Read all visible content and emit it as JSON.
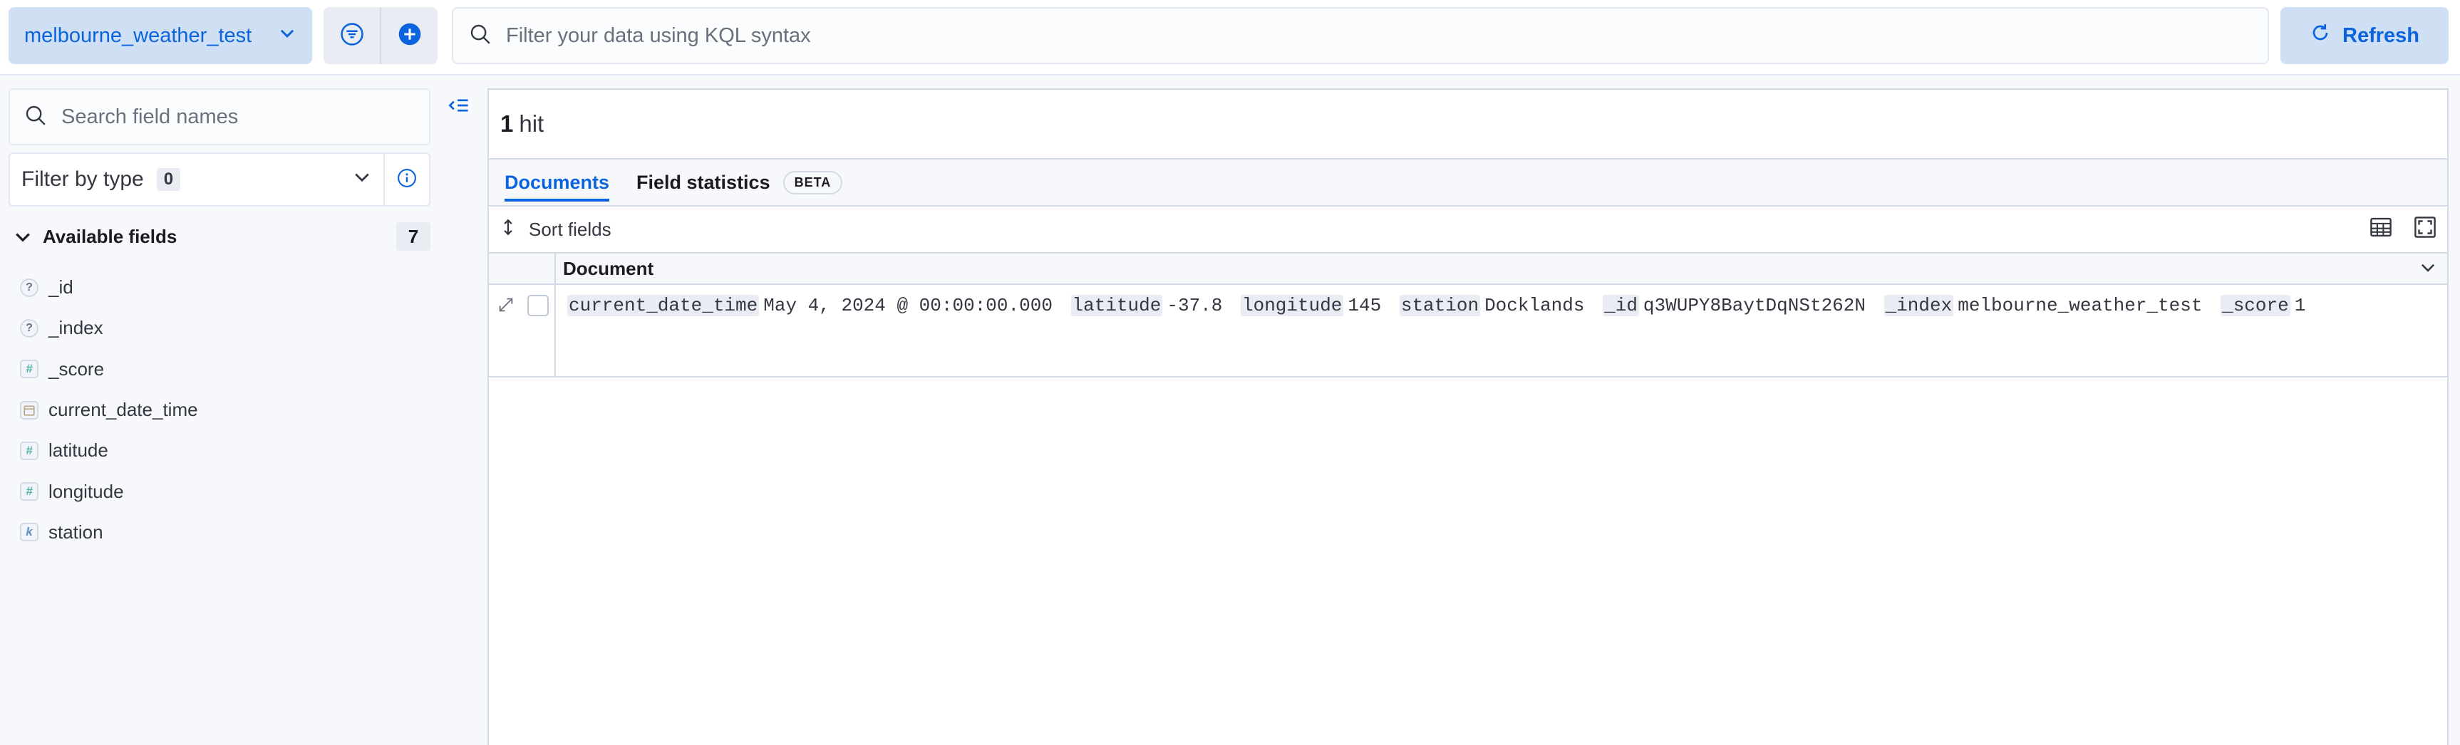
{
  "topbar": {
    "data_view": "melbourne_weather_test",
    "query_placeholder": "Filter your data using KQL syntax",
    "refresh_label": "Refresh"
  },
  "sidebar": {
    "search_placeholder": "Search field names",
    "filter_by_type": "Filter by type",
    "filter_count": "0",
    "available_fields_label": "Available fields",
    "available_fields_count": "7",
    "fields": [
      {
        "name": "_id",
        "type": "?"
      },
      {
        "name": "_index",
        "type": "?"
      },
      {
        "name": "_score",
        "type": "#"
      },
      {
        "name": "current_date_time",
        "type": "date"
      },
      {
        "name": "latitude",
        "type": "#"
      },
      {
        "name": "longitude",
        "type": "#"
      },
      {
        "name": "station",
        "type": "k"
      }
    ]
  },
  "main": {
    "hits_count": "1",
    "hits_label": "hit",
    "tabs": [
      {
        "label": "Documents"
      },
      {
        "label": "Field statistics"
      }
    ],
    "beta_label": "BETA",
    "sort_fields_label": "Sort fields",
    "column_header": "Document",
    "document": [
      {
        "key": "current_date_time",
        "value": "May 4, 2024 @ 00:00:00.000"
      },
      {
        "key": "latitude",
        "value": "-37.8"
      },
      {
        "key": "longitude",
        "value": "145"
      },
      {
        "key": "station",
        "value": "Docklands"
      },
      {
        "key": "_id",
        "value": "q3WUPY8BaytDqNSt262N"
      },
      {
        "key": "_index",
        "value": "melbourne_weather_test"
      },
      {
        "key": "_score",
        "value": "1"
      }
    ]
  },
  "colors": {
    "accent": "#0b64dd",
    "button_bg": "#cfe0f5",
    "page_bg": "#f7f8fc"
  }
}
